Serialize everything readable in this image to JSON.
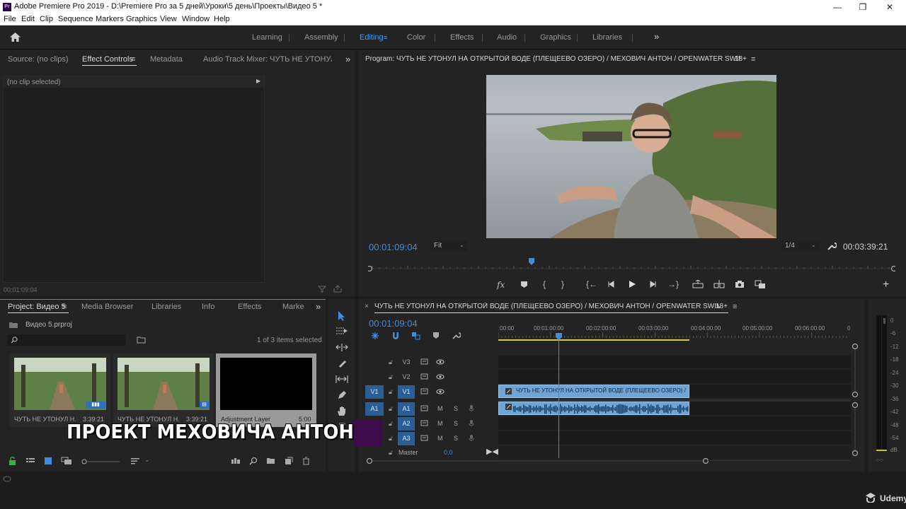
{
  "window": {
    "title": "Adobe Premiere Pro 2019 - D:\\Premiere Pro  за 5 дней\\Уроки\\5 день\\Проекты\\Видео 5 *",
    "app_icon": "Pr",
    "minimize": "—",
    "maximize": "❐",
    "close": "✕"
  },
  "menu": [
    "File",
    "Edit",
    "Clip",
    "Sequence",
    "Markers",
    "Graphics",
    "View",
    "Window",
    "Help"
  ],
  "workspaces": {
    "items": [
      "Learning",
      "Assembly",
      "Editing",
      "Color",
      "Effects",
      "Audio",
      "Graphics",
      "Libraries"
    ],
    "active": "Editing",
    "more": "»"
  },
  "source_panel": {
    "tabs": [
      "Source: (no clips)",
      "Effect Controls",
      "Metadata",
      "Audio Track Mixer: ЧУТЬ НЕ УТОНУЛ НА С"
    ],
    "active_tab": "Effect Controls",
    "menu_icon": "≡",
    "more": "»",
    "no_clip": "(no clip selected)",
    "timecode": "00:01:09:04"
  },
  "program_monitor": {
    "title": "Program: ЧУТЬ НЕ УТОНУЛ НА ОТКРЫТОЙ ВОДЕ (ПЛЕЩЕЕВО ОЗЕРО) / МЕХОВИЧ АНТОН / OPENWATER SWIMMING",
    "rating": "18+",
    "menu_icon": "≡",
    "timecode": "00:01:09:04",
    "fit": "Fit",
    "resolution": "1/4",
    "duration": "00:03:39:21",
    "playhead_fraction": 0.31
  },
  "project_panel": {
    "tabs": [
      "Project: Видео 5",
      "Media Browser",
      "Libraries",
      "Info",
      "Effects",
      "Marke"
    ],
    "active_tab": "Project: Видео 5",
    "menu_icon": "≡",
    "more": "»",
    "file": "Видео 5.prproj",
    "selection": "1 of 3 items selected",
    "items": [
      {
        "name": "ЧУТЬ НЕ УТОНУЛ Н...",
        "duration": "3:39:21"
      },
      {
        "name": "ЧУТЬ НЕ УТОНУЛ Н...",
        "duration": "3:39:21"
      },
      {
        "name": "Adjustment Layer",
        "duration": "5:00"
      }
    ]
  },
  "timeline": {
    "title": "ЧУТЬ НЕ УТОНУЛ НА ОТКРЫТОЙ ВОДЕ (ПЛЕЩЕЕВО ОЗЕРО) / МЕХОВИЧ АНТОН / OPENWATER SWIMMING",
    "rating": "18+",
    "close": "×",
    "menu_icon": "≡",
    "timecode": "00:01:09:04",
    "ruler": [
      ":00:00",
      "00:01:00:00",
      "00:02:00:00",
      "00:03:00:00",
      "00:04:00:00",
      "00:05:00:00",
      "00:06:00:00",
      "0"
    ],
    "tracks": {
      "video": [
        {
          "name": "V3",
          "source": ""
        },
        {
          "name": "V2",
          "source": ""
        },
        {
          "name": "V1",
          "source": "V1"
        }
      ],
      "audio": [
        {
          "name": "A1",
          "source": "A1"
        },
        {
          "name": "A2",
          "source": ""
        },
        {
          "name": "A3",
          "source": ""
        }
      ],
      "master": "Master",
      "master_value": "0,0"
    },
    "mute": "M",
    "solo": "S",
    "clip_label": "ЧУТЬ НЕ УТОНУЛ НА ОТКРЫТОЙ ВОДЕ (ПЛЕЩЕЕВО ОЗЕРО) / МЕХО"
  },
  "audio_meter": {
    "ticks": [
      "0",
      "-6",
      "-12",
      "-18",
      "-24",
      "-30",
      "-36",
      "-42",
      "-48",
      "-54",
      "dB"
    ]
  },
  "overlay": {
    "text": "ПРОЕКТ МЕХОВИЧА АНТОНА"
  },
  "watermark": "Udemy",
  "colors": {
    "accent": "#4a9cf0",
    "clip_blue": "#6fa4d6",
    "selected_track": "#2a5e97"
  }
}
